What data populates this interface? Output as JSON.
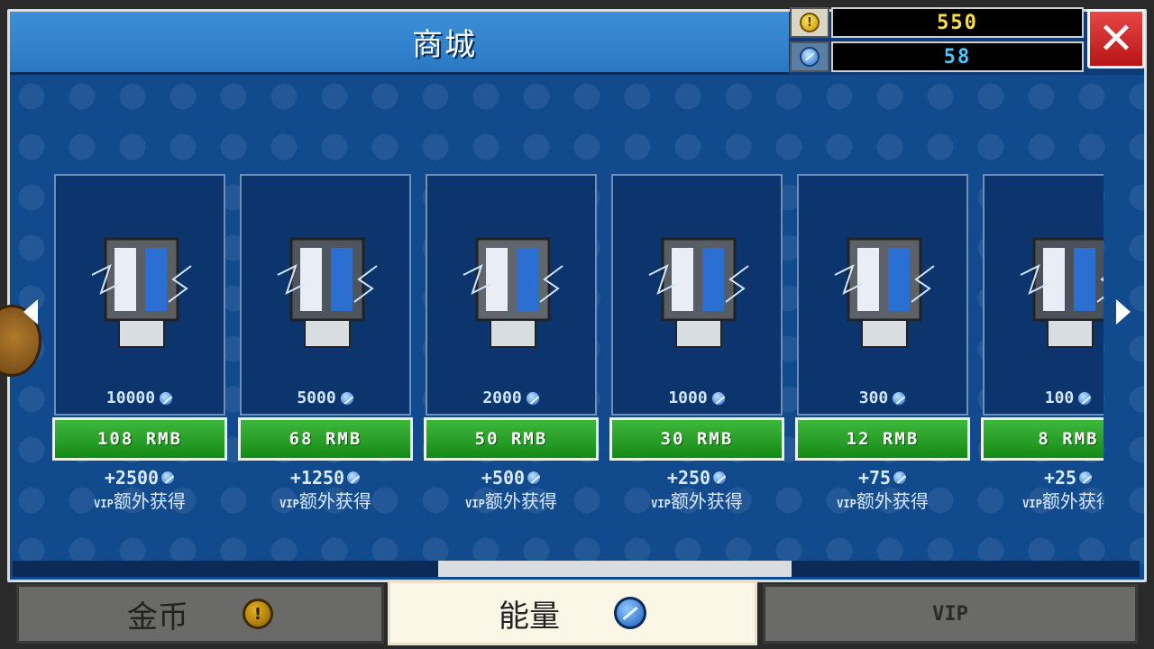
{
  "header": {
    "title": "商城"
  },
  "currency": {
    "coins": "550",
    "energy": "58",
    "coin_color": "#ffe040",
    "energy_color": "#4fc3ff"
  },
  "close": {
    "label": "✕"
  },
  "cards": [
    {
      "amount": "10000",
      "price": "108 RMB",
      "bonus": "+2500",
      "bonus_prefix": "VIP",
      "bonus_label": "额外获得"
    },
    {
      "amount": "5000",
      "price": "68 RMB",
      "bonus": "+1250",
      "bonus_prefix": "VIP",
      "bonus_label": "额外获得"
    },
    {
      "amount": "2000",
      "price": "50 RMB",
      "bonus": "+500",
      "bonus_prefix": "VIP",
      "bonus_label": "额外获得"
    },
    {
      "amount": "1000",
      "price": "30 RMB",
      "bonus": "+250",
      "bonus_prefix": "VIP",
      "bonus_label": "额外获得"
    },
    {
      "amount": "300",
      "price": "12 RMB",
      "bonus": "+75",
      "bonus_prefix": "VIP",
      "bonus_label": "额外获得"
    },
    {
      "amount": "100",
      "price": "8 RMB",
      "bonus": "+25",
      "bonus_prefix": "VIP",
      "bonus_label": "额外获得"
    }
  ],
  "tabs": {
    "gold": "金币",
    "energy": "能量",
    "vip": "VIP"
  },
  "icons": {
    "coin": "coin-icon",
    "energy": "energy-gem-icon",
    "close": "close-icon",
    "next": "arrow-right-icon",
    "prev": "arrow-left-icon"
  }
}
